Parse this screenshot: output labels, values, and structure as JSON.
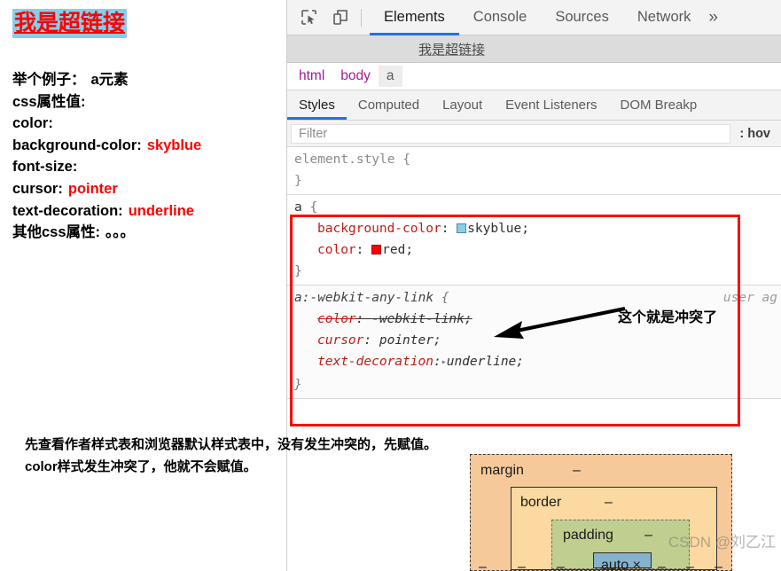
{
  "page": {
    "link_text": "我是超链接",
    "notes": [
      {
        "label": "举个例子：",
        "value": "a元素",
        "value_color": "#000000"
      },
      {
        "label": "css属性值:",
        "value": "",
        "value_color": "#000000"
      },
      {
        "label": "color:",
        "value": "",
        "value_color": "#000000"
      },
      {
        "label": "background-color:",
        "value": "skyblue",
        "value_color": "#ff0000"
      },
      {
        "label": "font-size:",
        "value": "",
        "value_color": "#000000"
      },
      {
        "label": "cursor:",
        "value": "pointer",
        "value_color": "#ff0000"
      },
      {
        "label": "text-decoration:",
        "value": "underline",
        "value_color": "#ff0000"
      },
      {
        "label": "其他css属性:",
        "value": "。。。",
        "value_color": "#000000"
      }
    ],
    "bottom_note_line1": "先查看作者样式表和浏览器默认样式表中，没有发生冲突的，先赋值。",
    "bottom_note_line2": "color样式发生冲突了，他就不会赋值。"
  },
  "devtools": {
    "toolbar": {
      "inspect_icon": "inspect-element-icon",
      "device_icon": "device-toolbar-icon",
      "tabs": [
        {
          "label": "Elements",
          "active": true
        },
        {
          "label": "Console",
          "active": false
        },
        {
          "label": "Sources",
          "active": false
        },
        {
          "label": "Network",
          "active": false
        }
      ],
      "more_tabs": "»"
    },
    "dom_preview": "我是超链接",
    "breadcrumb": [
      {
        "label": "html",
        "selected": false
      },
      {
        "label": "body",
        "selected": false
      },
      {
        "label": "a",
        "selected": true
      }
    ],
    "subtabs": [
      {
        "label": "Styles",
        "active": true
      },
      {
        "label": "Computed",
        "active": false
      },
      {
        "label": "Layout",
        "active": false
      },
      {
        "label": "Event Listeners",
        "active": false
      },
      {
        "label": "DOM Breakp",
        "active": false
      }
    ],
    "filter": {
      "placeholder": "Filter",
      "value": "",
      "hov_label": ": hov"
    },
    "rules": [
      {
        "selector": "element.style",
        "origin": "",
        "declarations": []
      },
      {
        "selector": "a",
        "origin": "",
        "declarations": [
          {
            "property": "background-color",
            "value": "skyblue",
            "swatch": "#87ceeb",
            "struck": false,
            "expandable": false
          },
          {
            "property": "color",
            "value": "red",
            "swatch": "#ff0000",
            "struck": false,
            "expandable": false
          }
        ]
      },
      {
        "selector": "a:-webkit-any-link",
        "origin": "user ag",
        "declarations": [
          {
            "property": "color",
            "value": "-webkit-link",
            "swatch": "",
            "struck": true,
            "expandable": false
          },
          {
            "property": "cursor",
            "value": "pointer",
            "swatch": "",
            "struck": false,
            "expandable": false
          },
          {
            "property": "text-decoration",
            "value": "underline",
            "swatch": "",
            "struck": false,
            "expandable": true
          }
        ]
      }
    ]
  },
  "annotation": {
    "conflict_label": "这个就是冲突了",
    "highlight_color": "#fe0000"
  },
  "box_model": {
    "margin_label": "margin",
    "margin_value": "–",
    "border_label": "border",
    "border_value": "–",
    "padding_label": "padding",
    "padding_value": "–",
    "content_value": "auto × auto",
    "dash": "–",
    "colors": {
      "margin": "#f6c99a",
      "border": "#fcd9a0",
      "padding": "#c0cf8f",
      "content": "#85b2cd"
    }
  },
  "watermark": "CSDN @刘乙江"
}
